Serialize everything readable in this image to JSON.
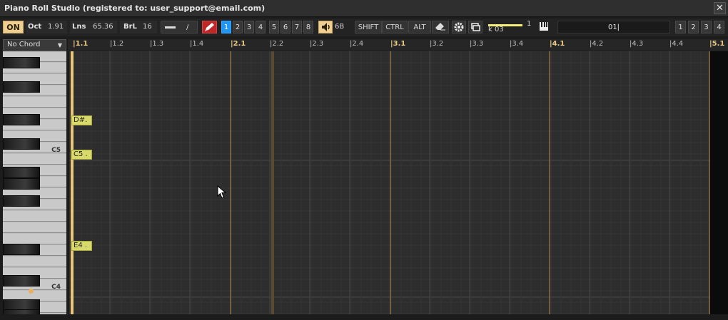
{
  "window": {
    "title": "Piano Roll Studio  (registered to: user_support@email.com)",
    "close_label": "✕"
  },
  "toolbar": {
    "on_label": "ON",
    "oct_label": "Oct",
    "oct_value": "1.91",
    "lns_label": "Lns",
    "lns_value": "65.36",
    "brl_label": "BrL",
    "brl_value": "16",
    "slash_label": "/",
    "midi_channels": [
      "1",
      "2",
      "3",
      "4",
      "5",
      "6",
      "7",
      "8"
    ],
    "active_channel": "1",
    "volume_value": "6B",
    "shift_label": "SHIFT",
    "ctrl_label": "CTRL",
    "alt_label": "ALT",
    "velocity_label": "k 03",
    "velocity_value": "1",
    "track_field_value": "01|",
    "page_buttons": [
      "1",
      "2",
      "3",
      "4"
    ]
  },
  "chord_selector": {
    "value": "No Chord"
  },
  "ruler": {
    "ticks": [
      "|1.1",
      "|1.2",
      "|1.3",
      "|1.4",
      "|2.1",
      "|2.2",
      "|2.3",
      "|2.4",
      "|3.1",
      "|3.2",
      "|3.3",
      "|3.4",
      "|4.1",
      "|4.2",
      "|4.3",
      "|4.4",
      "|5.1"
    ]
  },
  "keyboard": {
    "labels": [
      "C5",
      "C4"
    ]
  },
  "notes": [
    {
      "label": "D#."
    },
    {
      "label": "C5 ."
    },
    {
      "label": "E4 ."
    }
  ],
  "colors": {
    "accent": "#f0cf92",
    "note": "#dada6a",
    "playhead": "#e9c57a",
    "bar_line": "#b8864a",
    "active_channel": "#2196f3"
  }
}
